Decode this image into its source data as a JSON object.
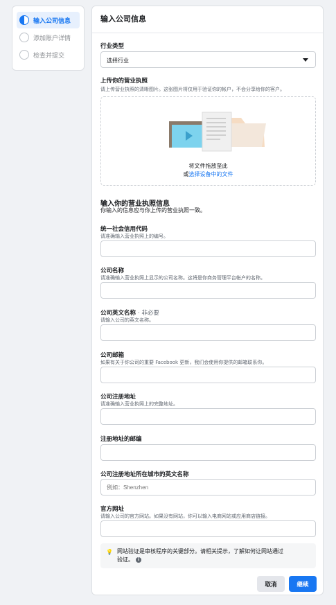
{
  "steps": [
    {
      "label": "输入公司信息",
      "active": true
    },
    {
      "label": "添加账户详情",
      "active": false
    },
    {
      "label": "检查并提交",
      "active": false
    }
  ],
  "panel": {
    "title": "输入公司信息"
  },
  "industry": {
    "label": "行业类型",
    "value": "选择行业"
  },
  "upload": {
    "label": "上传你的营业执照",
    "hint": "请上传营业执照的清晰图片。这张图片将仅用于验证你的帐户，不会分享给你的客户。",
    "drop_text": "将文件拖放至此",
    "or_text": "或",
    "select_link": "选择设备中的文件"
  },
  "license_section": {
    "title": "输入你的营业执照信息",
    "subtitle": "你输入的信息应与你上传的营业执照一致。"
  },
  "fields": {
    "credit_code": {
      "label": "统一社会信用代码",
      "hint": "请准确输入营业执照上的编号。",
      "placeholder": ""
    },
    "company_name": {
      "label": "公司名称",
      "hint": "请准确输入营业执照上显示的公司名称。这将是你商务管理平台帐户的名称。",
      "placeholder": ""
    },
    "company_name_en": {
      "label": "公司英文名称",
      "optional": "· 非必要",
      "hint": "请输入公司的英文名称。",
      "placeholder": ""
    },
    "company_email": {
      "label": "公司邮箱",
      "hint": "如果有关于你公司的重要 Facebook 更新，我们会使用你提供的邮箱联系你。",
      "placeholder": ""
    },
    "reg_address": {
      "label": "公司注册地址",
      "hint": "请准确输入营业执照上的完整地址。",
      "placeholder": ""
    },
    "postal_code": {
      "label": "注册地址的邮编",
      "placeholder": ""
    },
    "city_en": {
      "label": "公司注册地址所在城市的英文名称",
      "placeholder": "例如：Shenzhen"
    },
    "website": {
      "label": "官方网址",
      "hint": "请输入公司的官方网站。如果没有网站，你可以输入电商网站或应用商店链接。",
      "placeholder": ""
    }
  },
  "tip": {
    "line1": "网站验证是审核程序的关键部分。请相关提示，了解如何让网站通过",
    "line2": "验证。",
    "info_glyph": "i",
    "bulb_glyph": "💡"
  },
  "buttons": {
    "cancel": "取消",
    "next": "继续"
  },
  "colors": {
    "accent": "#1877f2",
    "background": "#f0f2f5"
  }
}
